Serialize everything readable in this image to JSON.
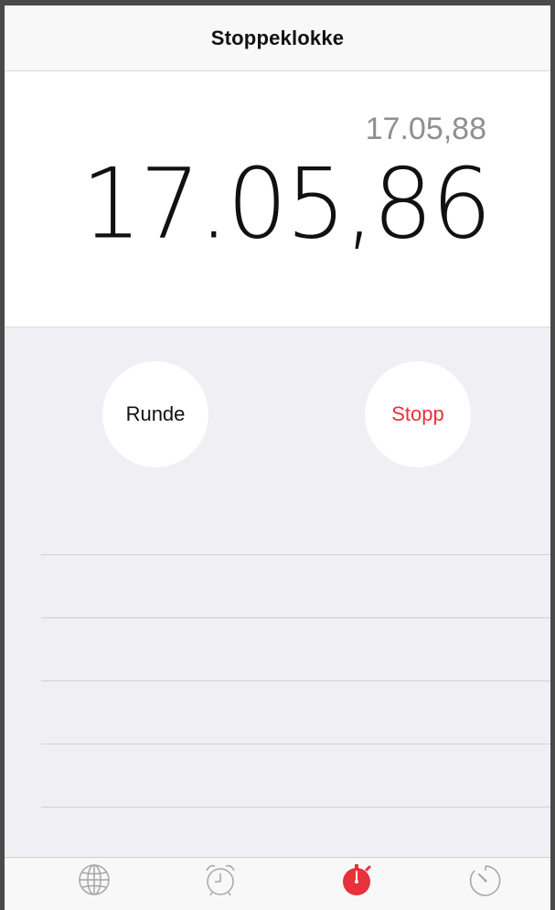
{
  "nav": {
    "title": "Stoppeklokke"
  },
  "timer": {
    "lap_time": "17.05,88",
    "main_time": "17.05,86"
  },
  "buttons": {
    "lap_label": "Runde",
    "stop_label": "Stopp"
  },
  "laps": [],
  "tabs": [
    {
      "icon": "globe-icon",
      "name": "world-clock",
      "active": false
    },
    {
      "icon": "alarm-clock-icon",
      "name": "alarm",
      "active": false
    },
    {
      "icon": "stopwatch-icon",
      "name": "stopwatch",
      "active": true
    },
    {
      "icon": "timer-icon",
      "name": "timer",
      "active": false
    }
  ],
  "colors": {
    "accent": "#e8313a",
    "background": "#efeff4",
    "inactive_icon": "#a6a6aa"
  }
}
